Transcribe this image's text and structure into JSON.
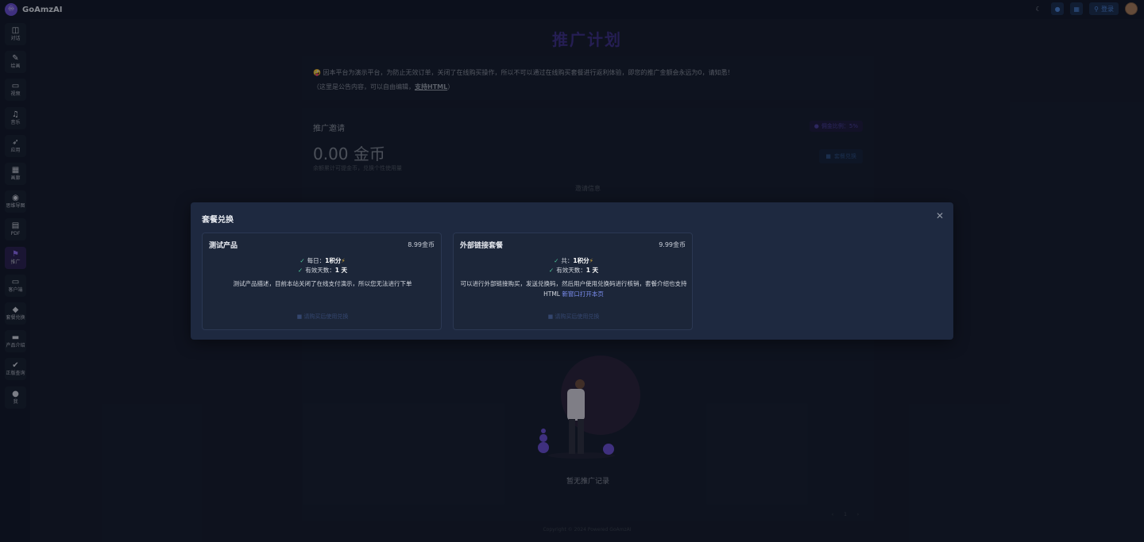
{
  "app": {
    "name": "GoAmzAI",
    "logo_glyph": "♾"
  },
  "topbar": {
    "theme_icon": "moon-icon",
    "login_label": "登录"
  },
  "sidebar": {
    "items": [
      {
        "label": "对话",
        "icon": "chat-icon",
        "glyph": "◫"
      },
      {
        "label": "绘画",
        "icon": "brush-icon",
        "glyph": "✎"
      },
      {
        "label": "视频",
        "icon": "video-icon",
        "glyph": "▭"
      },
      {
        "label": "音乐",
        "icon": "music-icon",
        "glyph": "♫"
      },
      {
        "label": "应用",
        "icon": "rocket-icon",
        "glyph": "➶"
      },
      {
        "label": "画廊",
        "icon": "gallery-icon",
        "glyph": "▦"
      },
      {
        "label": "思维导图",
        "icon": "mindmap-icon",
        "glyph": "◉"
      },
      {
        "label": "PDF",
        "icon": "pdf-icon",
        "glyph": "▤"
      },
      {
        "label": "推广",
        "icon": "promotion-icon",
        "glyph": "⚑",
        "active": true
      },
      {
        "label": "客户端",
        "icon": "monitor-icon",
        "glyph": "▭"
      },
      {
        "label": "套餐兑换",
        "icon": "diamond-icon",
        "glyph": "◆"
      },
      {
        "label": "产品介绍",
        "icon": "book-icon",
        "glyph": "▬"
      },
      {
        "label": "正版查询",
        "icon": "verified-icon",
        "glyph": "✔"
      },
      {
        "label": "我",
        "icon": "user-icon",
        "glyph": "●"
      }
    ]
  },
  "page": {
    "title": "推广计划",
    "notice": {
      "line1": "🤪 因本平台为演示平台，为防止无效订单，关闭了在线购买操作，所以不可以通过在线购买套餐进行返利体验，即您的推广金额会永远为0，请知悉！",
      "line2_prefix": "（这里是公告内容，可以自由编辑，",
      "line2_link": "支持HTML",
      "line2_suffix": "）"
    },
    "invite": {
      "title": "推广邀请",
      "amount": "0.00 金币",
      "note": "余额累计可提金币，兑换个性使用量",
      "commission_badge": "佣金比例：5%",
      "exchange_button": "套餐兑换",
      "info_label": "邀请信息",
      "empty_text": "暂无推广记录",
      "page_number": "1"
    },
    "copyright": "Copyright © 2024 Powered GoAmzAI"
  },
  "modal": {
    "title": "套餐兑换",
    "packages": [
      {
        "name": "测试产品",
        "price": "8.99金币",
        "feature1_prefix": "每日：",
        "feature1_value": "1积分",
        "feature2_prefix": "有效天数：",
        "feature2_value": "1 天",
        "desc": "测试产品描述，目前本站关闭了在线支付演示，所以您无法进行下单",
        "buy_label": "请购买后使用兑换"
      },
      {
        "name": "外部链接套餐",
        "price": "9.99金币",
        "feature1_prefix": "共：",
        "feature1_value": "1积分",
        "feature2_prefix": "有效天数：",
        "feature2_value": "1 天",
        "desc": "可以进行外部链接购买，发送兑换码，然后用户使用兑换码进行核销，套餐介绍也支持HTML ",
        "desc_link": "新窗口打开本页",
        "buy_label": "请购买后使用兑换"
      }
    ]
  },
  "colors": {
    "accent": "#6a4fd0",
    "check": "#4fc79b",
    "bolt": "#e6b53a",
    "link": "#7b8ef0"
  }
}
